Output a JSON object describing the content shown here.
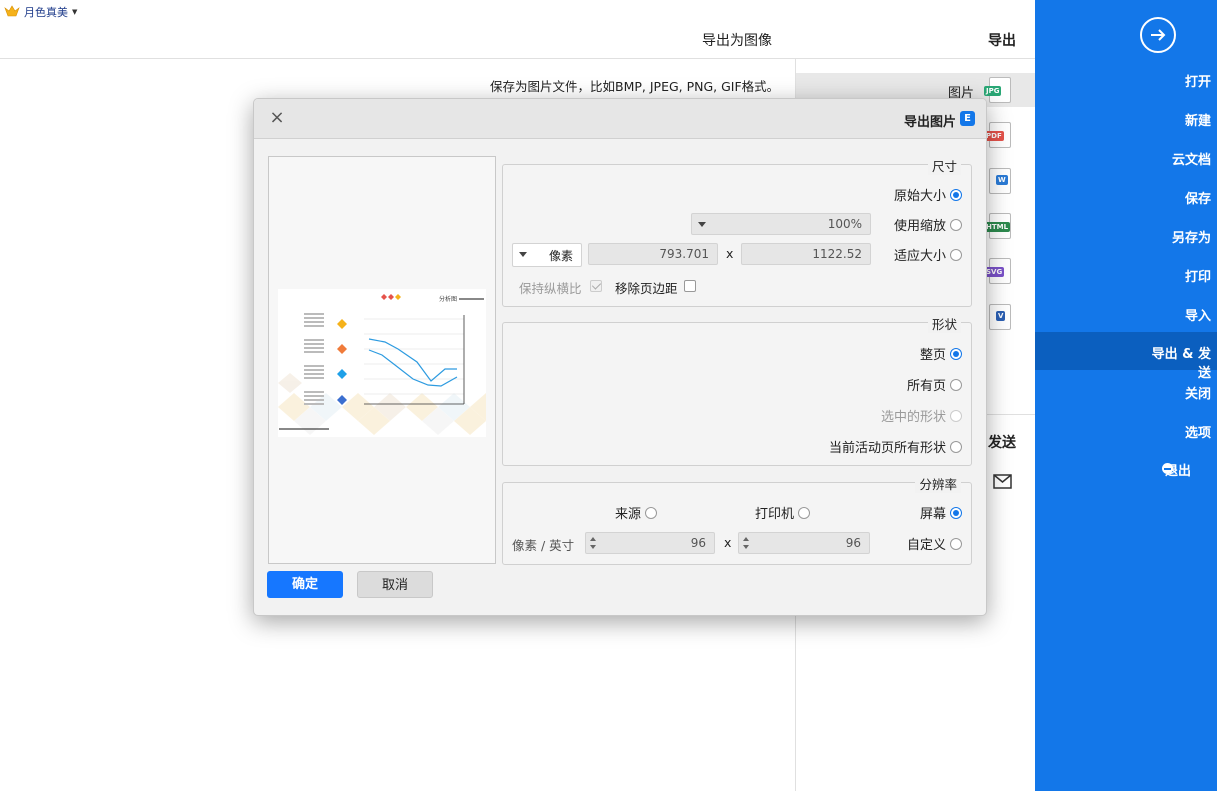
{
  "brand": {
    "name": "月色真美"
  },
  "header": {
    "section": "导出",
    "panel_title": "导出为图像"
  },
  "description": "保存为图片文件，比如BMP, JPEG, PNG, GIF格式。",
  "formats": [
    {
      "label": "图片",
      "badge": "JPG",
      "color": "#2aa876",
      "selected": true
    },
    {
      "label": "",
      "badge": "PDF",
      "color": "#e5534b",
      "selected": false
    },
    {
      "label": "",
      "badge": "W",
      "color": "#2b7bd6",
      "selected": false
    },
    {
      "label": "",
      "badge": "HTML",
      "color": "#2d8a4e",
      "selected": false
    },
    {
      "label": "",
      "badge": "SVG",
      "color": "#7b52c9",
      "selected": false
    },
    {
      "label": "",
      "badge": "V",
      "color": "#2b5fb3",
      "selected": false
    }
  ],
  "send": {
    "label": "发送"
  },
  "sidebar": {
    "items": [
      {
        "label": "打开"
      },
      {
        "label": "新建"
      },
      {
        "label": "云文档"
      },
      {
        "label": "保存"
      },
      {
        "label": "另存为"
      },
      {
        "label": "打印"
      },
      {
        "label": "导入"
      },
      {
        "label": "导出 & 发送",
        "active": true
      },
      {
        "label": "关闭"
      },
      {
        "label": "选项"
      },
      {
        "label": "退出"
      }
    ]
  },
  "dialog": {
    "title": "导出图片",
    "logo": "E",
    "close": "×",
    "size_group": {
      "title": "尺寸",
      "original": "原始大小",
      "zoom": "使用缩放",
      "zoom_value": "100%",
      "fit": "适应大小",
      "width": "1122.52",
      "x_sep": "x",
      "height": "793.701",
      "unit": "像素",
      "remove_margin": "移除页边距",
      "keep_ratio": "保持纵横比"
    },
    "shape_group": {
      "title": "形状",
      "whole_page": "整页",
      "all_pages": "所有页",
      "selected_shapes": "选中的形状",
      "active_page_shapes": "当前活动页所有形状"
    },
    "resolution_group": {
      "title": "分辨率",
      "screen": "屏幕",
      "printer": "打印机",
      "source": "来源",
      "custom": "自定义",
      "dpi_x": "96",
      "x_sep": "x",
      "dpi_y": "96",
      "unit": "像素 / 英寸"
    },
    "ok": "确定",
    "cancel": "取消",
    "preview": {
      "chart_title": "分析图"
    }
  }
}
